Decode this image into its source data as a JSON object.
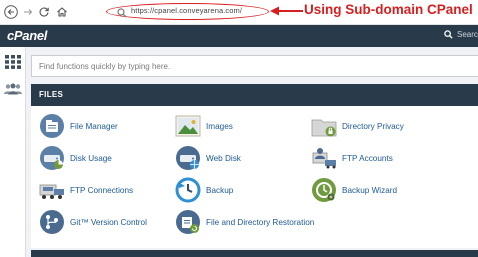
{
  "browser": {
    "url": "https://cpanel.conveyarena.com/",
    "annotation": "Using Sub-domain CPanel"
  },
  "header": {
    "logo": "cPanel",
    "search_label": "Search"
  },
  "quick_search": {
    "placeholder": "Find functions quickly by typing here."
  },
  "files": {
    "title": "FILES",
    "items": [
      {
        "label": "File Manager",
        "icon": "file-manager-icon"
      },
      {
        "label": "Images",
        "icon": "images-icon"
      },
      {
        "label": "Directory Privacy",
        "icon": "directory-privacy-icon"
      },
      {
        "label": "Disk Usage",
        "icon": "disk-usage-icon"
      },
      {
        "label": "Web Disk",
        "icon": "web-disk-icon"
      },
      {
        "label": "FTP Accounts",
        "icon": "ftp-accounts-icon"
      },
      {
        "label": "FTP Connections",
        "icon": "ftp-connections-icon"
      },
      {
        "label": "Backup",
        "icon": "backup-icon"
      },
      {
        "label": "Backup Wizard",
        "icon": "backup-wizard-icon"
      },
      {
        "label": "Git™ Version Control",
        "icon": "git-icon"
      },
      {
        "label": "File and Directory Restoration",
        "icon": "file-restoration-icon"
      }
    ]
  },
  "colors": {
    "header_bg": "#293a4a",
    "link": "#1e5a94",
    "annotation": "#d81f1f"
  }
}
